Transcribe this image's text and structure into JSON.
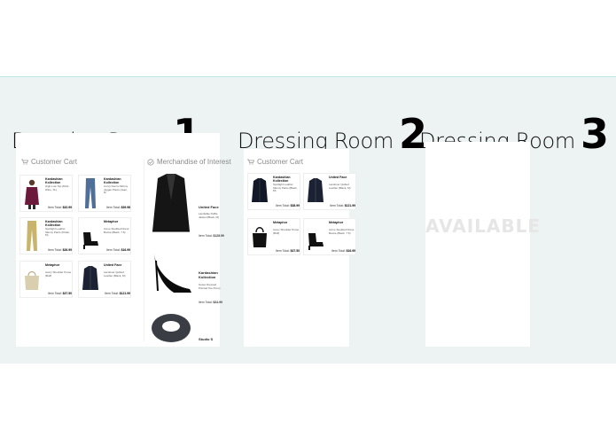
{
  "rooms": [
    {
      "name": "Dressing Room",
      "number": "1"
    },
    {
      "name": "Dressing Room",
      "number": "2"
    },
    {
      "name": "Dressing Room",
      "number": "3"
    }
  ],
  "room1": {
    "cart_label": "Customer Cart",
    "merch_label": "Merchandise of Interest",
    "cart": [
      {
        "brand": "Kardashian Kollection",
        "desc": "High-Low Top (Dark Wine, XL)",
        "total_label": "Item Total:",
        "price": "$32.99"
      },
      {
        "brand": "Kardashian Kollection",
        "desc": "Curvy Denim Skinny Jegger Pants (Jean, 8)",
        "total_label": "Item Total:",
        "price": "$39.98"
      },
      {
        "brand": "Kardashian Kollection",
        "desc": "Spotlight Leather Skinny Pants (Khaki, M)",
        "total_label": "Item Total:",
        "price": "$26.99"
      },
      {
        "brand": "Metaphor",
        "desc": "Acme Studded Dress Bootie (Black, 7.5)",
        "total_label": "Item Total:",
        "price": "$16.99"
      },
      {
        "brand": "Metaphor",
        "desc": "Avery Shoulder Purse (Buff)",
        "total_label": "Item Total:",
        "price": "$37.50"
      },
      {
        "brand": "United Face",
        "desc": "Landover Quilted Leather (Black, M)",
        "total_label": "Item Total:",
        "price": "$121.99"
      }
    ],
    "merch": [
      {
        "brand": "United Face",
        "desc": "Landslide Ruffle Jacket (Black, M)",
        "total_label": "Item Total:",
        "price": "$128.99"
      },
      {
        "brand": "Kardashian Kollection",
        "desc": "Grace Dressed Pointed Toe Pump",
        "total_label": "Item Total:",
        "price": "$24.99"
      },
      {
        "brand": "Studio S",
        "desc": "",
        "total_label": "",
        "price": ""
      }
    ]
  },
  "room2": {
    "cart_label": "Customer Cart",
    "cart": [
      {
        "brand": "Kardashian Kollection",
        "desc": "Spotlight Leather Skinny Pants (Black, M)",
        "total_label": "Item Total:",
        "price": "$38.99"
      },
      {
        "brand": "United Face",
        "desc": "Landover Quilted Leather (Black, M)",
        "total_label": "Item Total:",
        "price": "$121.99"
      },
      {
        "brand": "Metaphor",
        "desc": "Avery Shoulder Purse (Buff)",
        "total_label": "Item Total:",
        "price": "$37.50"
      },
      {
        "brand": "Metaphor",
        "desc": "Acme Studded Dress Bootie (Black, 7.5)",
        "total_label": "Item Total:",
        "price": "$16.99"
      }
    ]
  },
  "room3": {
    "status": "AVAILABLE"
  },
  "colors": {
    "band": "#edf2f2",
    "band_border": "#bfe6e6",
    "available_text": "#e6e6e6"
  }
}
